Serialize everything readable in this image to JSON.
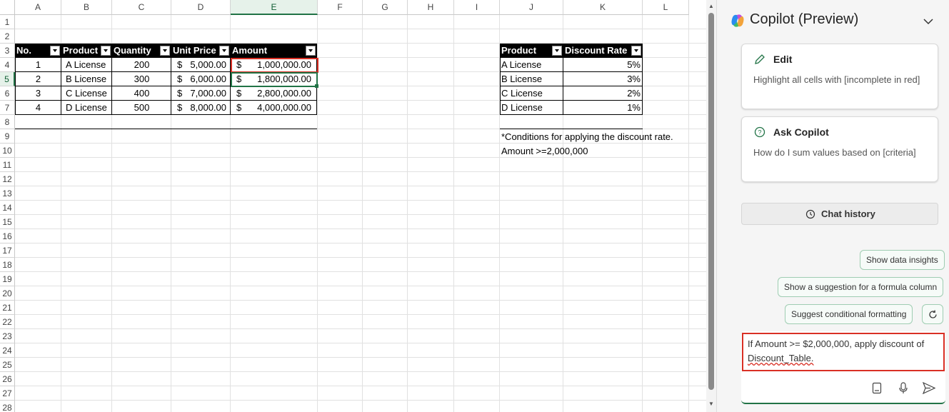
{
  "columns": [
    "A",
    "B",
    "C",
    "D",
    "E",
    "F",
    "G",
    "H",
    "I",
    "J",
    "K",
    "L"
  ],
  "rows": [
    "1",
    "2",
    "3",
    "4",
    "5",
    "6",
    "7",
    "8",
    "9",
    "10",
    "11",
    "12",
    "13",
    "14",
    "15",
    "16",
    "17",
    "18",
    "19",
    "20",
    "21",
    "22",
    "23",
    "24",
    "25",
    "26",
    "27",
    "28"
  ],
  "table1": {
    "headers": [
      "No.",
      "Product",
      "Quantity",
      "Unit Price",
      "Amount"
    ],
    "rows": [
      {
        "no": "1",
        "product": "A License",
        "qty": "200",
        "price": "5,000.00",
        "amount": "1,000,000.00"
      },
      {
        "no": "2",
        "product": "B License",
        "qty": "300",
        "price": "6,000.00",
        "amount": "1,800,000.00"
      },
      {
        "no": "3",
        "product": "C License",
        "qty": "400",
        "price": "7,000.00",
        "amount": "2,800,000.00"
      },
      {
        "no": "4",
        "product": "D License",
        "qty": "500",
        "price": "8,000.00",
        "amount": "4,000,000.00"
      }
    ],
    "currency": "$"
  },
  "table2": {
    "headers": [
      "Product",
      "Discount Rate"
    ],
    "rows": [
      {
        "product": "A License",
        "rate": "5%"
      },
      {
        "product": "B License",
        "rate": "3%"
      },
      {
        "product": "C License",
        "rate": "2%"
      },
      {
        "product": "D License",
        "rate": "1%"
      }
    ]
  },
  "notes": {
    "line1": "*Conditions for applying the discount rate.",
    "line2": "Amount >=2,000,000"
  },
  "copilot": {
    "title": "Copilot (Preview)",
    "edit_card": {
      "title": "Edit",
      "body": "Highlight all cells with [incomplete in red]"
    },
    "ask_card": {
      "title": "Ask Copilot",
      "body": "How do I sum values based on [criteria]"
    },
    "chat_history": "Chat history",
    "suggestions": [
      "Show data insights",
      "Show a suggestion for a formula column",
      "Suggest conditional formatting"
    ],
    "input_line1": "If Amount >= $2,000,000, apply discount of",
    "input_line2": "Discount_Table."
  }
}
